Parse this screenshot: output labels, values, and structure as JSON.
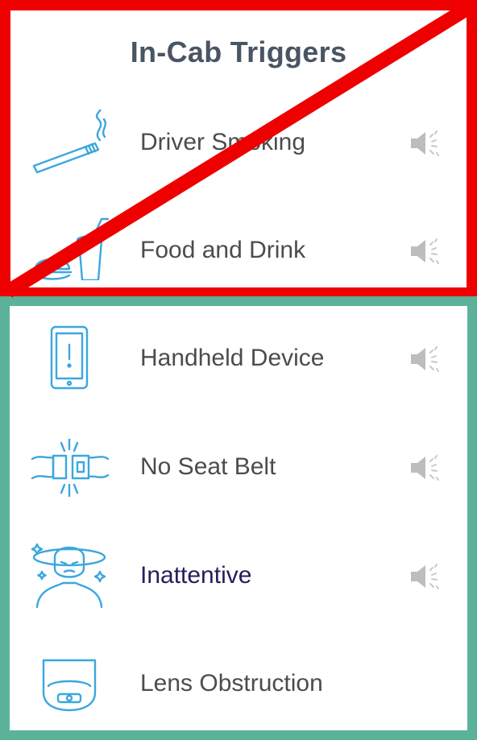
{
  "title": "In-Cab Triggers",
  "colors": {
    "disabled_frame": "#ee0000",
    "enabled_frame": "#5bb298",
    "icon": "#3ba7de",
    "speaker": "#bdbdbd"
  },
  "triggers": [
    {
      "label": "Driver Smoking",
      "icon": "cigarette-icon",
      "speaker": "speaker-icon"
    },
    {
      "label": "Food and Drink",
      "icon": "food-drink-icon",
      "speaker": "speaker-icon"
    },
    {
      "label": "Handheld Device",
      "icon": "phone-icon",
      "speaker": "speaker-icon"
    },
    {
      "label": "No Seat Belt",
      "icon": "seatbelt-icon",
      "speaker": "speaker-icon"
    },
    {
      "label": "Inattentive",
      "icon": "dizzy-driver-icon",
      "speaker": "speaker-icon"
    },
    {
      "label": "Lens Obstruction",
      "icon": "camera-lens-icon"
    }
  ]
}
